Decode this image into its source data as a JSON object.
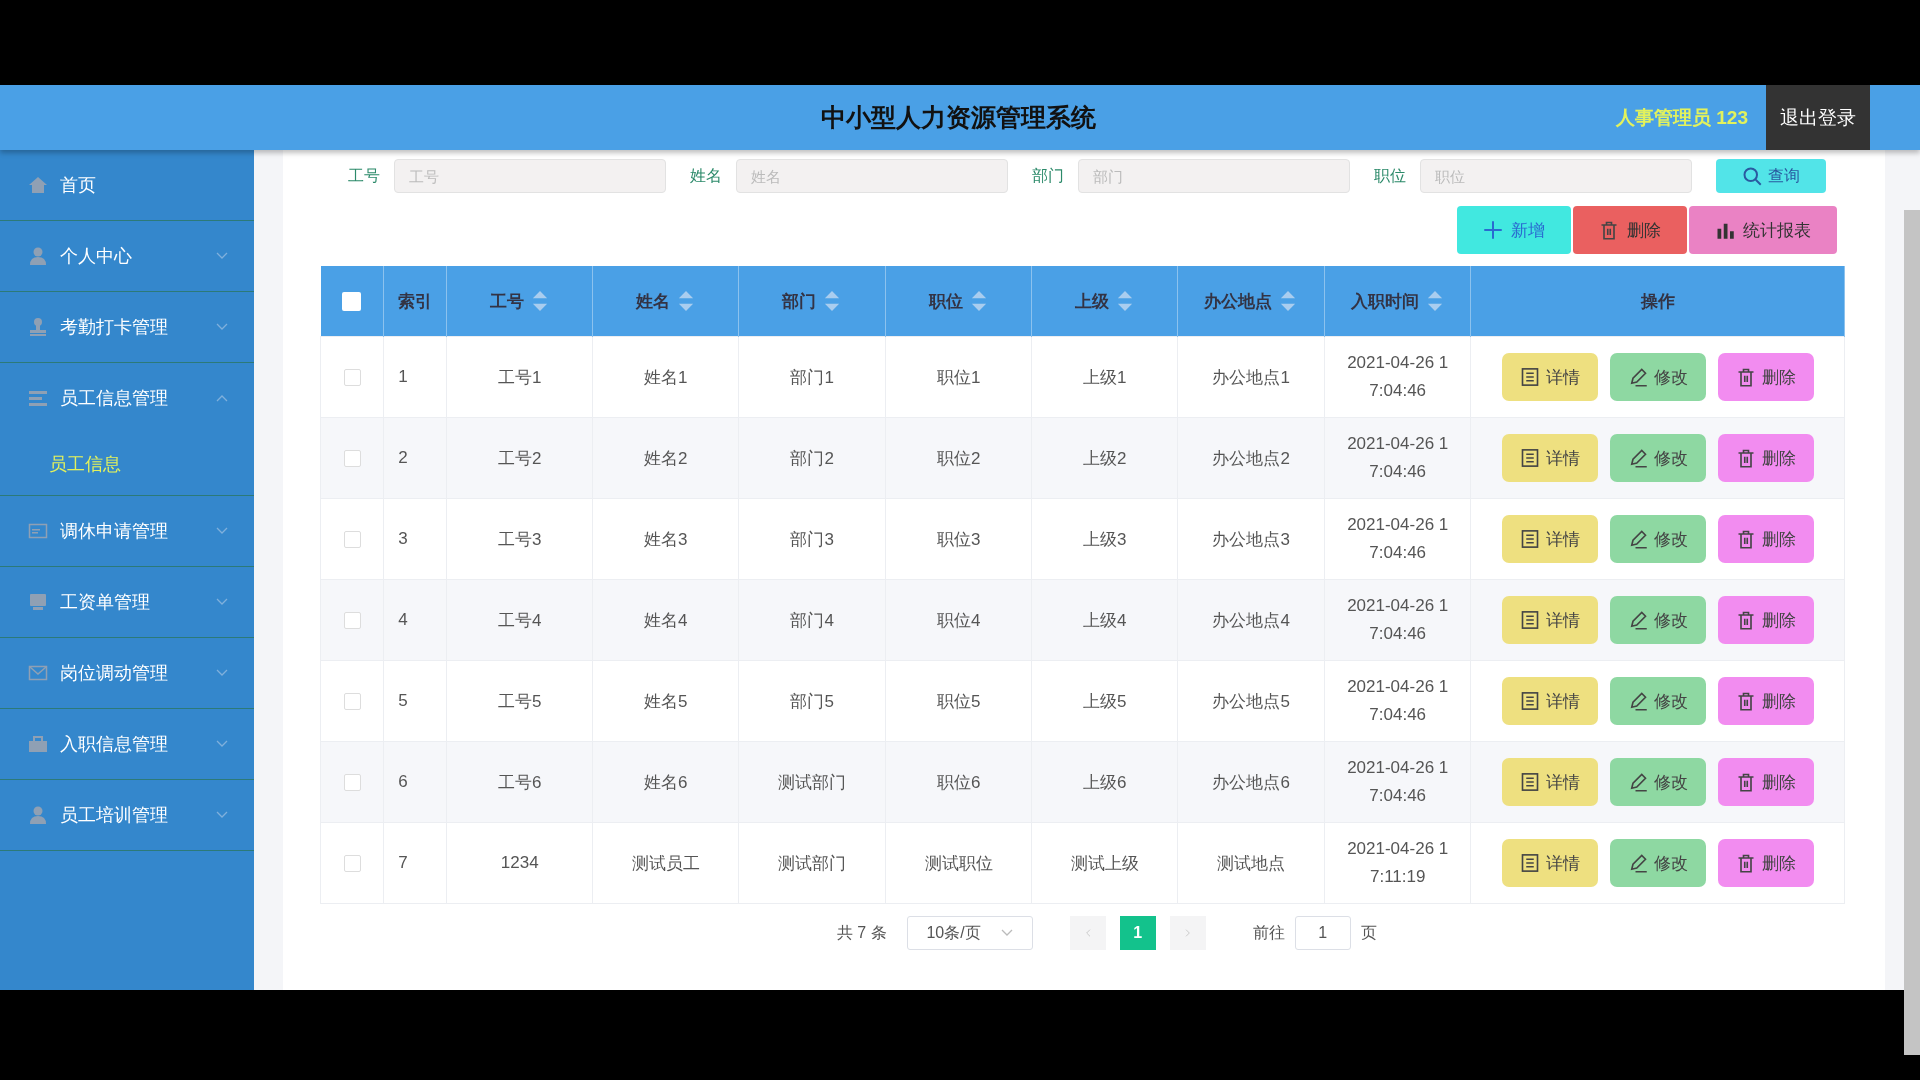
{
  "header": {
    "title": "中小型人力资源管理系统",
    "user": "人事管理员 123",
    "logout": "退出登录"
  },
  "sidebar": {
    "items": [
      {
        "label": "首页"
      },
      {
        "label": "个人中心",
        "expanded": false
      },
      {
        "label": "考勤打卡管理",
        "expanded": false
      },
      {
        "label": "员工信息管理",
        "expanded": true,
        "children": [
          {
            "label": "员工信息",
            "selected": true
          }
        ]
      },
      {
        "label": "调休申请管理",
        "expanded": false
      },
      {
        "label": "工资单管理",
        "expanded": false
      },
      {
        "label": "岗位调动管理",
        "expanded": false
      },
      {
        "label": "入职信息管理",
        "expanded": false
      },
      {
        "label": "员工培训管理",
        "expanded": false
      }
    ]
  },
  "search": {
    "fields": [
      {
        "label": "工号",
        "placeholder": "工号"
      },
      {
        "label": "姓名",
        "placeholder": "姓名"
      },
      {
        "label": "部门",
        "placeholder": "部门"
      },
      {
        "label": "职位",
        "placeholder": "职位"
      }
    ],
    "button": "查询"
  },
  "toolbar": [
    {
      "kind": "add",
      "label": "新增"
    },
    {
      "kind": "delete",
      "label": "删除"
    },
    {
      "kind": "report",
      "label": "统计报表"
    }
  ],
  "table": {
    "select_all_checked": false,
    "columns": [
      {
        "label": "索引",
        "sortable": false
      },
      {
        "label": "工号",
        "sortable": true
      },
      {
        "label": "姓名",
        "sortable": true
      },
      {
        "label": "部门",
        "sortable": true
      },
      {
        "label": "职位",
        "sortable": true
      },
      {
        "label": "上级",
        "sortable": true
      },
      {
        "label": "办公地点",
        "sortable": true
      },
      {
        "label": "入职时间",
        "sortable": true
      },
      {
        "label": "操作",
        "sortable": false
      }
    ],
    "rows": [
      {
        "checked": false,
        "cells": [
          "1",
          "工号1",
          "姓名1",
          "部门1",
          "职位1",
          "上级1",
          "办公地点1",
          "2021-04-26 17:04:46"
        ],
        "actions": [
          {
            "kind": "detail",
            "label": "详情"
          },
          {
            "kind": "edit",
            "label": "修改"
          },
          {
            "kind": "delete",
            "label": "删除"
          }
        ]
      },
      {
        "checked": false,
        "cells": [
          "2",
          "工号2",
          "姓名2",
          "部门2",
          "职位2",
          "上级2",
          "办公地点2",
          "2021-04-26 17:04:46"
        ],
        "actions": [
          {
            "kind": "detail",
            "label": "详情"
          },
          {
            "kind": "edit",
            "label": "修改"
          },
          {
            "kind": "delete",
            "label": "删除"
          }
        ]
      },
      {
        "checked": false,
        "cells": [
          "3",
          "工号3",
          "姓名3",
          "部门3",
          "职位3",
          "上级3",
          "办公地点3",
          "2021-04-26 17:04:46"
        ],
        "actions": [
          {
            "kind": "detail",
            "label": "详情"
          },
          {
            "kind": "edit",
            "label": "修改"
          },
          {
            "kind": "delete",
            "label": "删除"
          }
        ]
      },
      {
        "checked": false,
        "cells": [
          "4",
          "工号4",
          "姓名4",
          "部门4",
          "职位4",
          "上级4",
          "办公地点4",
          "2021-04-26 17:04:46"
        ],
        "actions": [
          {
            "kind": "detail",
            "label": "详情"
          },
          {
            "kind": "edit",
            "label": "修改"
          },
          {
            "kind": "delete",
            "label": "删除"
          }
        ]
      },
      {
        "checked": false,
        "cells": [
          "5",
          "工号5",
          "姓名5",
          "部门5",
          "职位5",
          "上级5",
          "办公地点5",
          "2021-04-26 17:04:46"
        ],
        "actions": [
          {
            "kind": "detail",
            "label": "详情"
          },
          {
            "kind": "edit",
            "label": "修改"
          },
          {
            "kind": "delete",
            "label": "删除"
          }
        ]
      },
      {
        "checked": false,
        "cells": [
          "6",
          "工号6",
          "姓名6",
          "测试部门",
          "职位6",
          "上级6",
          "办公地点6",
          "2021-04-26 17:04:46"
        ],
        "actions": [
          {
            "kind": "detail",
            "label": "详情"
          },
          {
            "kind": "edit",
            "label": "修改"
          },
          {
            "kind": "delete",
            "label": "删除"
          }
        ]
      },
      {
        "checked": false,
        "cells": [
          "7",
          "1234",
          "测试员工",
          "测试部门",
          "测试职位",
          "测试上级",
          "测试地点",
          "2021-04-26 17:11:19"
        ],
        "actions": [
          {
            "kind": "detail",
            "label": "详情"
          },
          {
            "kind": "edit",
            "label": "修改"
          },
          {
            "kind": "delete",
            "label": "删除"
          }
        ]
      }
    ]
  },
  "pagination": {
    "total": "共 7 条",
    "page_size": "10条/页",
    "prev_disabled": true,
    "next_disabled": true,
    "pages": [
      {
        "label": "1",
        "selected": true
      }
    ],
    "goto_label": "前往",
    "goto_value": "1",
    "goto_suffix": "页"
  }
}
